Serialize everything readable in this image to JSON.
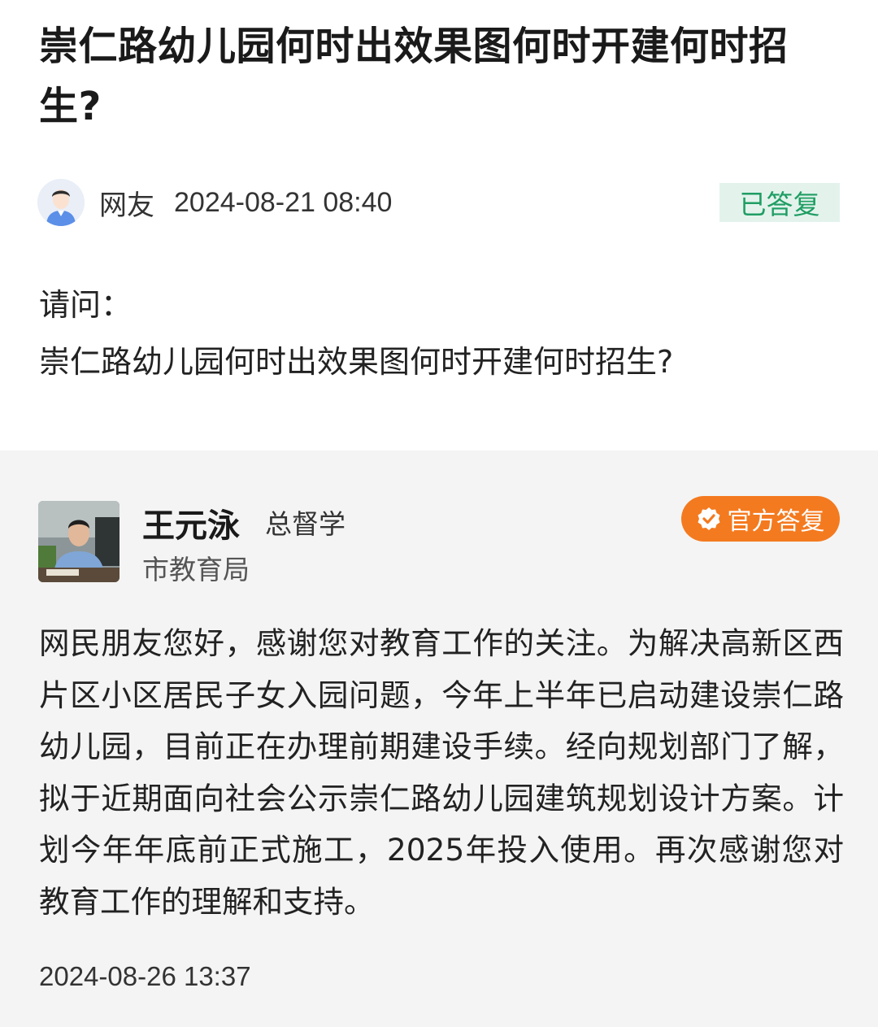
{
  "question": {
    "title": "崇仁路幼儿园何时出效果图何时开建何时招生?",
    "asker_name": "网友",
    "asker_time": "2024-08-21 08:40",
    "status": "已答复",
    "body_line1": "请问：",
    "body_line2": "崇仁路幼儿园何时出效果图何时开建何时招生?"
  },
  "answer": {
    "name": "王元泳",
    "title": "总督学",
    "department": "市教育局",
    "badge_label": "官方答复",
    "body": "网民朋友您好，感谢您对教育工作的关注。为解决高新区西片区小区居民子女入园问题，今年上半年已启动建设崇仁路幼儿园，目前正在办理前期建设手续。经向规划部门了解，拟于近期面向社会公示崇仁路幼儿园建筑规划设计方案。计划今年年底前正式施工，2025年投入使用。再次感谢您对教育工作的理解和支持。",
    "time": "2024-08-26 13:37"
  },
  "icons": {
    "asker_avatar": "user-avatar-icon",
    "badge_icon": "verified-check-icon"
  },
  "colors": {
    "status_bg": "#e3f3ec",
    "status_text": "#1f9d63",
    "official_badge": "#f47a1f",
    "answer_bg": "#f4f4f4"
  }
}
